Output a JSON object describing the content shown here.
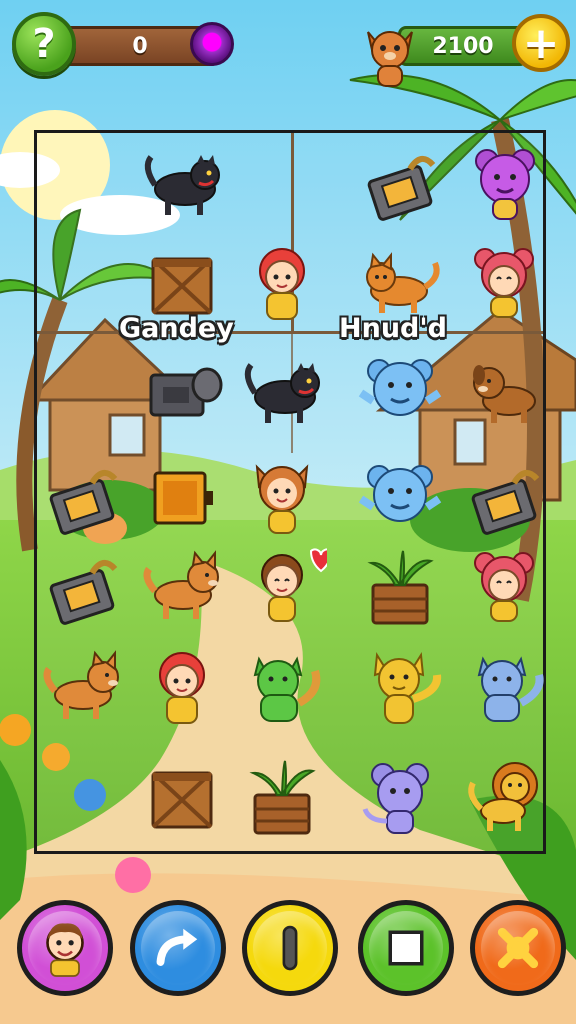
{
  "hud": {
    "help_label": "?",
    "score": "0",
    "coins": "2100",
    "add_label": "+"
  },
  "board": {
    "player_left": "Gandey",
    "player_right": "Hnud'd"
  },
  "pieces": [
    {
      "row": 0,
      "col": 1,
      "kind": "black-panther"
    },
    {
      "row": 0,
      "col": 3,
      "kind": "lock-crate"
    },
    {
      "row": 0,
      "col": 4,
      "kind": "purple-bear"
    },
    {
      "row": 1,
      "col": 1,
      "kind": "wooden-crate"
    },
    {
      "row": 1,
      "col": 2,
      "kind": "red-hair-girl"
    },
    {
      "row": 1,
      "col": 3,
      "kind": "orange-cat"
    },
    {
      "row": 1,
      "col": 4,
      "kind": "red-bear-girl"
    },
    {
      "row": 2,
      "col": 1,
      "kind": "stone-block"
    },
    {
      "row": 2,
      "col": 2,
      "kind": "black-panther"
    },
    {
      "row": 2,
      "col": 3,
      "kind": "blue-bear"
    },
    {
      "row": 2,
      "col": 4,
      "kind": "brown-dog"
    },
    {
      "row": 3,
      "col": 0,
      "kind": "lock-crate"
    },
    {
      "row": 3,
      "col": 1,
      "kind": "gold-box"
    },
    {
      "row": 3,
      "col": 2,
      "kind": "fox-kid"
    },
    {
      "row": 3,
      "col": 3,
      "kind": "blue-bear"
    },
    {
      "row": 3,
      "col": 4,
      "kind": "lock-crate"
    },
    {
      "row": 4,
      "col": 0,
      "kind": "lock-crate"
    },
    {
      "row": 4,
      "col": 1,
      "kind": "orange-dog"
    },
    {
      "row": 4,
      "col": 2,
      "kind": "brown-hair-kid"
    },
    {
      "row": 4,
      "col": 3,
      "kind": "plant-crate"
    },
    {
      "row": 4,
      "col": 4,
      "kind": "red-bear-girl"
    },
    {
      "row": 5,
      "col": 0,
      "kind": "orange-dog"
    },
    {
      "row": 5,
      "col": 1,
      "kind": "red-hair-girl"
    },
    {
      "row": 5,
      "col": 2,
      "kind": "green-cat"
    },
    {
      "row": 5,
      "col": 3,
      "kind": "yellow-fox"
    },
    {
      "row": 5,
      "col": 4,
      "kind": "blue-cat"
    },
    {
      "row": 6,
      "col": 1,
      "kind": "wooden-crate"
    },
    {
      "row": 6,
      "col": 2,
      "kind": "plant-crate"
    },
    {
      "row": 6,
      "col": 3,
      "kind": "purple-mouse"
    },
    {
      "row": 6,
      "col": 4,
      "kind": "lion"
    }
  ],
  "toolbar": {
    "items": [
      {
        "name": "avatar-button",
        "icon": "character-avatar-icon",
        "color": "#d14fd6"
      },
      {
        "name": "redo-button",
        "icon": "curved-arrow-icon",
        "color": "#2e8de0"
      },
      {
        "name": "pause-button",
        "icon": "bar-icon",
        "color": "#f5d90d"
      },
      {
        "name": "square-button",
        "icon": "square-icon",
        "color": "#5cc22a"
      },
      {
        "name": "shuffle-button",
        "icon": "x-cross-icon",
        "color": "#f06a1a"
      }
    ]
  }
}
